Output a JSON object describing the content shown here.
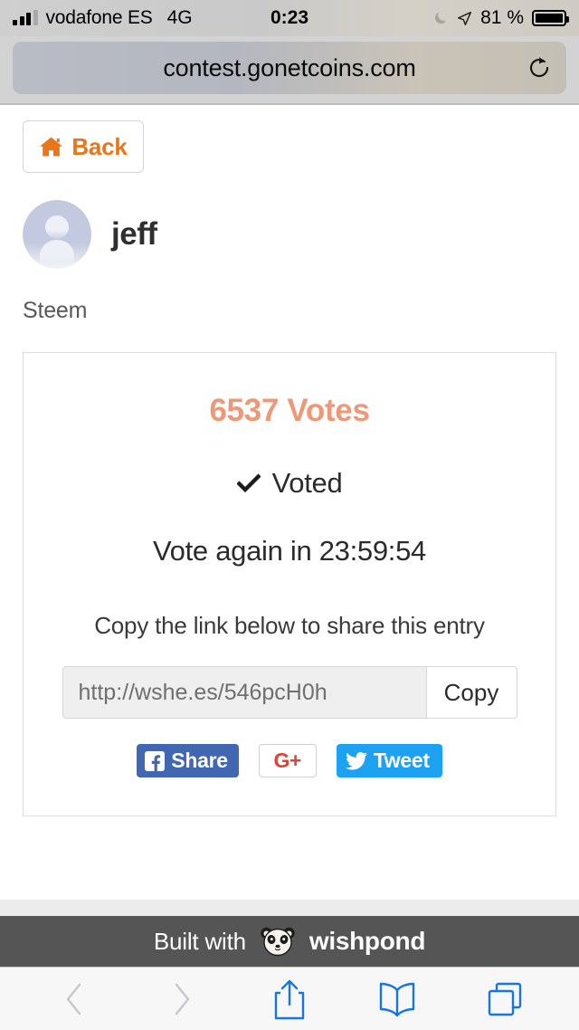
{
  "status_bar": {
    "signal_icon": "cellular-signal-icon",
    "carrier": "vodafone ES",
    "network": "4G",
    "time": "0:23",
    "dnd_icon": "moon-icon",
    "location_icon": "location-arrow-icon",
    "battery_percent": "81 %",
    "battery_icon": "battery-icon"
  },
  "browser": {
    "url": "contest.gonetcoins.com",
    "reload_icon": "reload-icon",
    "toolbar": {
      "back_icon": "chevron-left-icon",
      "forward_icon": "chevron-right-icon",
      "share_icon": "share-icon",
      "bookmarks_icon": "book-icon",
      "tabs_icon": "tabs-icon"
    }
  },
  "page": {
    "back_button": {
      "label": "Back",
      "icon": "home-icon",
      "color": "#e8761b"
    },
    "profile": {
      "avatar_icon": "default-avatar-icon",
      "username": "jeff",
      "subtitle": "Steem"
    },
    "card": {
      "votes_count": "6537",
      "votes_label": "Votes",
      "votes_text": "6537 Votes",
      "votes_color": "#ef9876",
      "voted_icon": "check-icon",
      "voted_label": "Voted",
      "vote_again_text": "Vote again in 23:59:54",
      "vote_again_timer": "23:59:54",
      "share_prompt": "Copy the link below to share this entry",
      "share_link": "http://wshe.es/546pcH0h",
      "share_link_placeholder": "http://wshe.es/546pcH0h",
      "copy_button": "Copy",
      "social": {
        "facebook": {
          "label": "Share",
          "icon": "facebook-icon",
          "color": "#4267b2"
        },
        "google_plus": {
          "label": "G+",
          "icon": "google-plus-icon",
          "color": "#db4437"
        },
        "twitter": {
          "label": "Tweet",
          "icon": "twitter-icon",
          "color": "#1da1f2"
        }
      }
    }
  },
  "footer": {
    "built_with": "Built with",
    "brand": "wishpond",
    "logo_icon": "panda-icon",
    "background": "#555555"
  }
}
